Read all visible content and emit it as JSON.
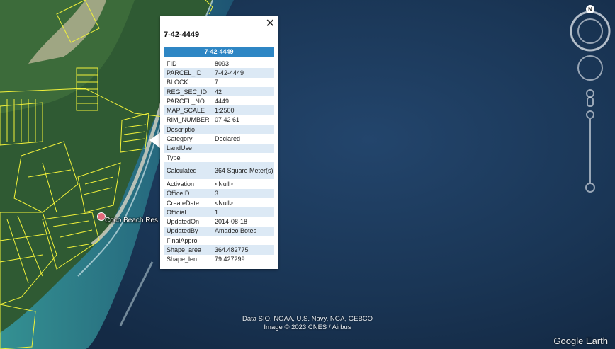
{
  "popup": {
    "title": "7-42-4449",
    "header": "7-42-4449",
    "close_glyph": "✕",
    "rows": [
      {
        "key": "FID",
        "value": "8093"
      },
      {
        "key": "PARCEL_ID",
        "value": "7-42-4449"
      },
      {
        "key": "BLOCK",
        "value": "7"
      },
      {
        "key": "REG_SEC_ID",
        "value": "42"
      },
      {
        "key": "PARCEL_NO",
        "value": "4449"
      },
      {
        "key": "MAP_SCALE",
        "value": "1:2500"
      },
      {
        "key": "RIM_NUMBER",
        "value": "07 42 61"
      },
      {
        "key": "Descriptio",
        "value": ""
      },
      {
        "key": "Category",
        "value": "Declared"
      },
      {
        "key": "LandUse",
        "value": ""
      },
      {
        "key": "Type",
        "value": ""
      },
      {
        "key": "Calculated",
        "value": "364 Square Meter(s)"
      },
      {
        "key": "Activation",
        "value": "<Null>"
      },
      {
        "key": "OfficeID",
        "value": "3"
      },
      {
        "key": "CreateDate",
        "value": "<Null>"
      },
      {
        "key": "Official",
        "value": "1"
      },
      {
        "key": "UpdatedOn",
        "value": "2014-08-18"
      },
      {
        "key": "UpdatedBy",
        "value": "Amadeo Botes"
      },
      {
        "key": "FinalAppro",
        "value": ""
      },
      {
        "key": "Shape_area",
        "value": "364.482775"
      },
      {
        "key": "Shape_len",
        "value": "79.427299"
      }
    ]
  },
  "place_label": "Coco Beach Res",
  "attribution": {
    "line1": "Data SIO, NOAA, U.S. Navy, NGA, GEBCO",
    "line2": "Image © 2023 CNES / Airbus"
  },
  "logo": "Google Earth",
  "compass": {
    "north_label": "N"
  },
  "colors": {
    "ocean": "#1b3a5c",
    "parcel_lines": "#f2f23a",
    "popup_header": "#2e86c4",
    "row_alt": "#dce9f5"
  }
}
